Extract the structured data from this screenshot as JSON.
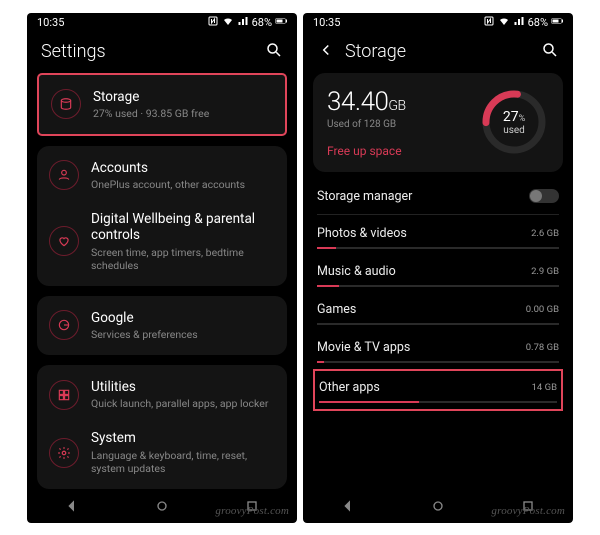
{
  "status": {
    "time": "10:35",
    "battery": "68%"
  },
  "left": {
    "title": "Settings",
    "storage": {
      "title": "Storage",
      "sub": "27% used · 93.85 GB free"
    },
    "accounts": {
      "title": "Accounts",
      "sub": "OnePlus account, other accounts"
    },
    "wellbeing": {
      "title": "Digital Wellbeing & parental controls",
      "sub": "Screen time, app timers, bedtime schedules"
    },
    "google": {
      "title": "Google",
      "sub": "Services & preferences"
    },
    "utilities": {
      "title": "Utilities",
      "sub": "Quick launch, parallel apps, app locker"
    },
    "system": {
      "title": "System",
      "sub": "Language & keyboard, time, reset, system updates"
    }
  },
  "right": {
    "title": "Storage",
    "used_value": "34.40",
    "used_unit": "GB",
    "used_sub": "Used of 128 GB",
    "ring_pct": "27",
    "ring_pct_unit": "%",
    "ring_label": "used",
    "freeup": "Free up space",
    "manager": "Storage manager",
    "cats": {
      "photos": {
        "name": "Photos & videos",
        "val": "2.6 GB"
      },
      "music": {
        "name": "Music & audio",
        "val": "2.9 GB"
      },
      "games": {
        "name": "Games",
        "val": "0.00 GB"
      },
      "movie": {
        "name": "Movie & TV apps",
        "val": "0.78 GB"
      },
      "other": {
        "name": "Other apps",
        "val": "14 GB"
      }
    }
  },
  "watermark": "groovyPost.com",
  "colors": {
    "accent": "#d83a56",
    "highlight": "#e0455a"
  },
  "chart_data": {
    "type": "bar",
    "title": "Storage usage by category (GB)",
    "total_gb": 128,
    "used_gb": 34.4,
    "used_pct": 27,
    "categories": [
      "Photos & videos",
      "Music & audio",
      "Games",
      "Movie & TV apps",
      "Other apps"
    ],
    "values": [
      2.6,
      2.9,
      0.0,
      0.78,
      14
    ],
    "xlabel": "",
    "ylabel": "GB",
    "ylim": [
      0,
      14
    ]
  }
}
